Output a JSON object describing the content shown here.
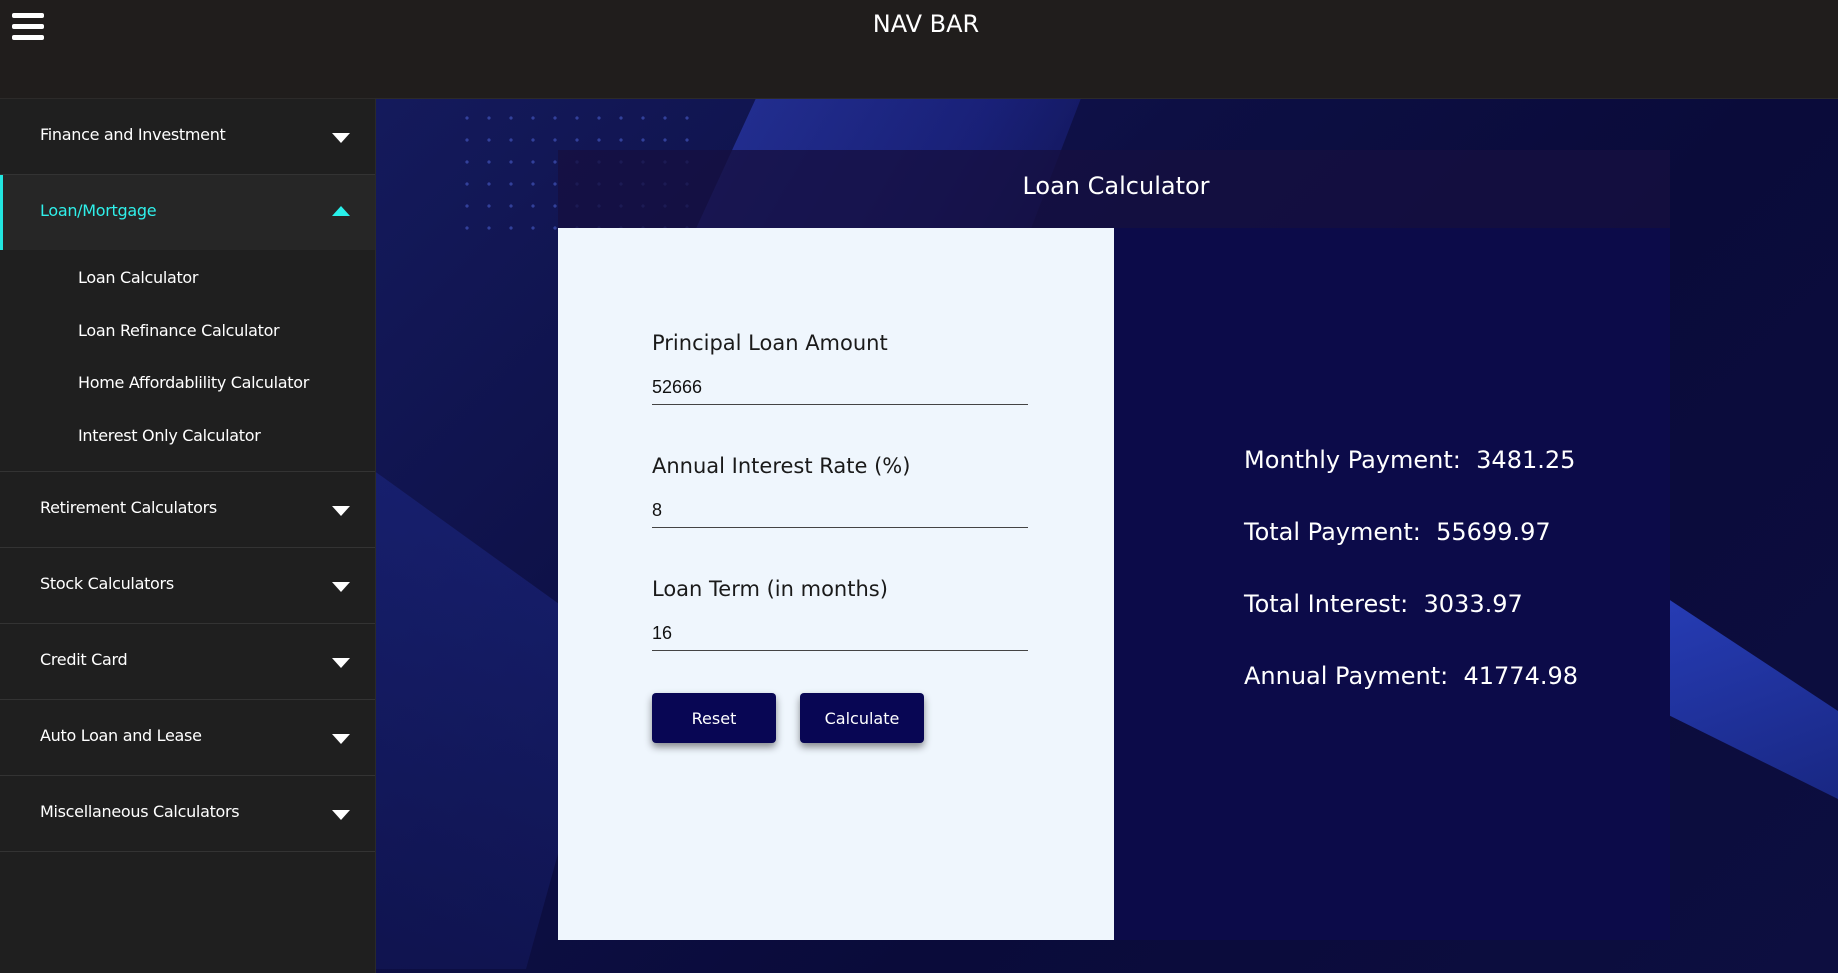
{
  "navbar": {
    "title": "NAV BAR",
    "menu_icon": "hamburger-icon"
  },
  "sidebar": {
    "sections": [
      {
        "label": "Finance and Investment",
        "expanded": false
      },
      {
        "label": "Loan/Mortgage",
        "expanded": true,
        "items": [
          "Loan Calculator",
          "Loan Refinance Calculator",
          "Home Affordablility Calculator",
          "Interest Only Calculator"
        ]
      },
      {
        "label": "Retirement Calculators",
        "expanded": false
      },
      {
        "label": "Stock Calculators",
        "expanded": false
      },
      {
        "label": "Credit Card",
        "expanded": false
      },
      {
        "label": "Auto Loan and Lease",
        "expanded": false
      },
      {
        "label": "Miscellaneous Calculators",
        "expanded": false
      }
    ],
    "accent_color": "#22e6e0"
  },
  "calculator": {
    "title": "Loan Calculator",
    "fields": [
      {
        "label": "Principal Loan Amount",
        "value": "52666"
      },
      {
        "label": "Annual Interest Rate (%)",
        "value": "8"
      },
      {
        "label": "Loan Term (in months)",
        "value": "16"
      }
    ],
    "buttons": {
      "reset": "Reset",
      "calculate": "Calculate"
    },
    "results": {
      "monthly_label": "Monthly Payment:",
      "monthly_value": "3481.25",
      "total_label": "Total Payment:",
      "total_value": "55699.97",
      "interest_label": "Total Interest:",
      "interest_value": "3033.97",
      "annual_label": "Annual Payment:",
      "annual_value": "41774.98"
    },
    "button_color": "#080654"
  }
}
